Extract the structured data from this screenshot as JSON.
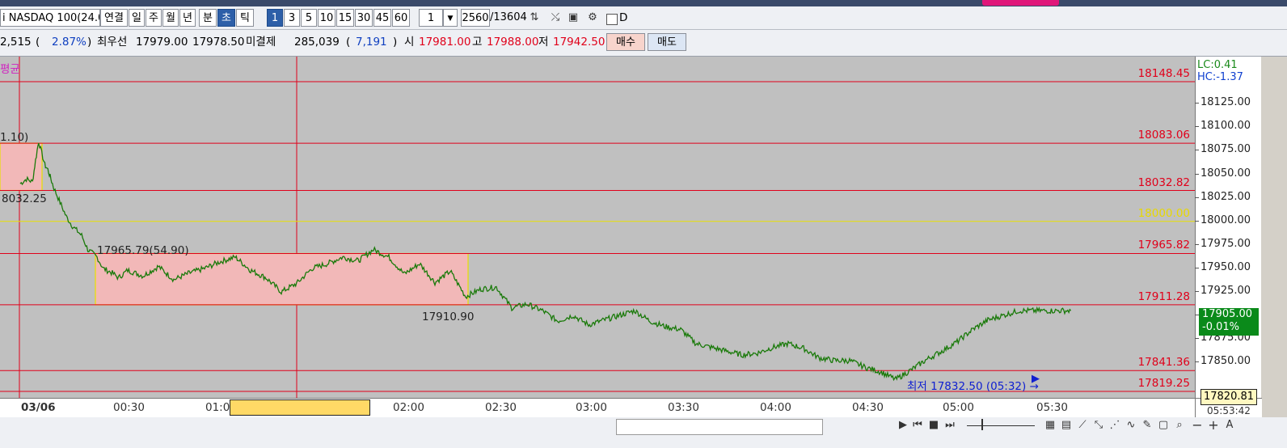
{
  "toolbar": {
    "symbol": "i NASDAQ 100(24.0",
    "period_buttons": [
      "연결",
      "일",
      "주",
      "월",
      "년",
      "분",
      "초",
      "틱"
    ],
    "selected_period": "초",
    "interval_buttons": [
      "1",
      "3",
      "5",
      "10",
      "15",
      "30",
      "45",
      "60"
    ],
    "selected_interval": "1",
    "multiplier": "1",
    "count_value": "2560",
    "count_total": "/13604",
    "d_label": "D"
  },
  "quote": {
    "change": "2,515",
    "change_open": "(",
    "change_pct": "2.87%",
    "change_close": ")",
    "best_label": "최우선",
    "best_ask": "17979.00",
    "best_bid": "17978.50",
    "open_interest_label": "미결제",
    "open_interest": "285,039",
    "oi_open": "(",
    "oi_change": "7,191",
    "oi_close": ")",
    "open_label": "시",
    "open": "17981.00",
    "high_label": "고",
    "high": "17988.00",
    "low_label": "저",
    "low": "17942.50",
    "buy_label": "매수",
    "sell_label": "매도"
  },
  "chart_data": {
    "type": "line",
    "indicator_label": "평균",
    "lc_label": "LC:0.41",
    "hc_label": "HC:-1.37",
    "y_ticks": [
      "18125.00",
      "18100.00",
      "18075.00",
      "18050.00",
      "18025.00",
      "18000.00",
      "17975.00",
      "17950.00",
      "17925.00",
      "17900.00",
      "17875.00",
      "17850.00"
    ],
    "x_ticks": [
      "03/06",
      "00:30",
      "01:0",
      "02:00",
      "02:30",
      "03:00",
      "03:30",
      "04:00",
      "04:30",
      "05:00",
      "05:30"
    ],
    "x_right_label": "05:53:42",
    "ylim": [
      17819.25,
      18148.45
    ],
    "horizontal_levels": [
      {
        "value": 18148.45,
        "label": "18148.45",
        "color": "#e0001a"
      },
      {
        "value": 18083.06,
        "label": "18083.06",
        "color": "#e0001a"
      },
      {
        "value": 18032.82,
        "label": "18032.82",
        "color": "#e0001a"
      },
      {
        "value": 18000.0,
        "label": "18000.00",
        "color": "#e8e000"
      },
      {
        "value": 17965.82,
        "label": "17965.82",
        "color": "#e0001a"
      },
      {
        "value": 17911.28,
        "label": "17911.28",
        "color": "#e0001a"
      },
      {
        "value": 17841.36,
        "label": "17841.36",
        "color": "#e0001a"
      },
      {
        "value": 17819.25,
        "label": "17819.25",
        "color": "#e0001a"
      }
    ],
    "annotations": {
      "a1": "1.10)",
      "a2": "8032.25",
      "a3": "17965.79(54.90)",
      "a4": "17910.90",
      "low_marker": "최저 17832.50 (05:32) →"
    },
    "current_price": "17905.00",
    "current_change": "-0.01%",
    "cursor_price": "17820.81",
    "series": [
      {
        "color": "#1a7a0a",
        "x_minutes": [
          0,
          2,
          4,
          5,
          6,
          8,
          9,
          10,
          11,
          13,
          15,
          17,
          20,
          22,
          25,
          27,
          30,
          32,
          35,
          40,
          45,
          50,
          55,
          60,
          65,
          70,
          75,
          80,
          85,
          90,
          95,
          100,
          105,
          110,
          115,
          120,
          125,
          130,
          135,
          140,
          145,
          150,
          155,
          160,
          165,
          170,
          175,
          180,
          185,
          190,
          195,
          200,
          205,
          210,
          215,
          220,
          225,
          230,
          235,
          240,
          245,
          250,
          255,
          260,
          265,
          270,
          275,
          280,
          285,
          290,
          295,
          300,
          305,
          310,
          315,
          320,
          325,
          330,
          335,
          340,
          342
        ],
        "values": [
          18040,
          18045,
          18042,
          18065,
          18085,
          18060,
          18055,
          18045,
          18035,
          18020,
          18005,
          17995,
          17985,
          17970,
          17962,
          17950,
          17945,
          17940,
          17948,
          17942,
          17952,
          17938,
          17945,
          17950,
          17957,
          17962,
          17948,
          17940,
          17925,
          17934,
          17950,
          17955,
          17962,
          17958,
          17970,
          17962,
          17944,
          17955,
          17935,
          17947,
          17920,
          17928,
          17930,
          17908,
          17912,
          17905,
          17894,
          17900,
          17890,
          17895,
          17900,
          17905,
          17894,
          17888,
          17885,
          17870,
          17866,
          17862,
          17858,
          17860,
          17866,
          17870,
          17865,
          17855,
          17852,
          17852,
          17845,
          17840,
          17832,
          17842,
          17853,
          17862,
          17872,
          17885,
          17895,
          17900,
          17905,
          17905,
          17905,
          17905,
          17905
        ]
      }
    ]
  },
  "bottom": {
    "nav_play": "▶",
    "nav_first": "⏮",
    "nav_stop": "■",
    "nav_last": "⏭",
    "zoom_out": "−",
    "zoom_in": "+",
    "auto_label": "A"
  }
}
